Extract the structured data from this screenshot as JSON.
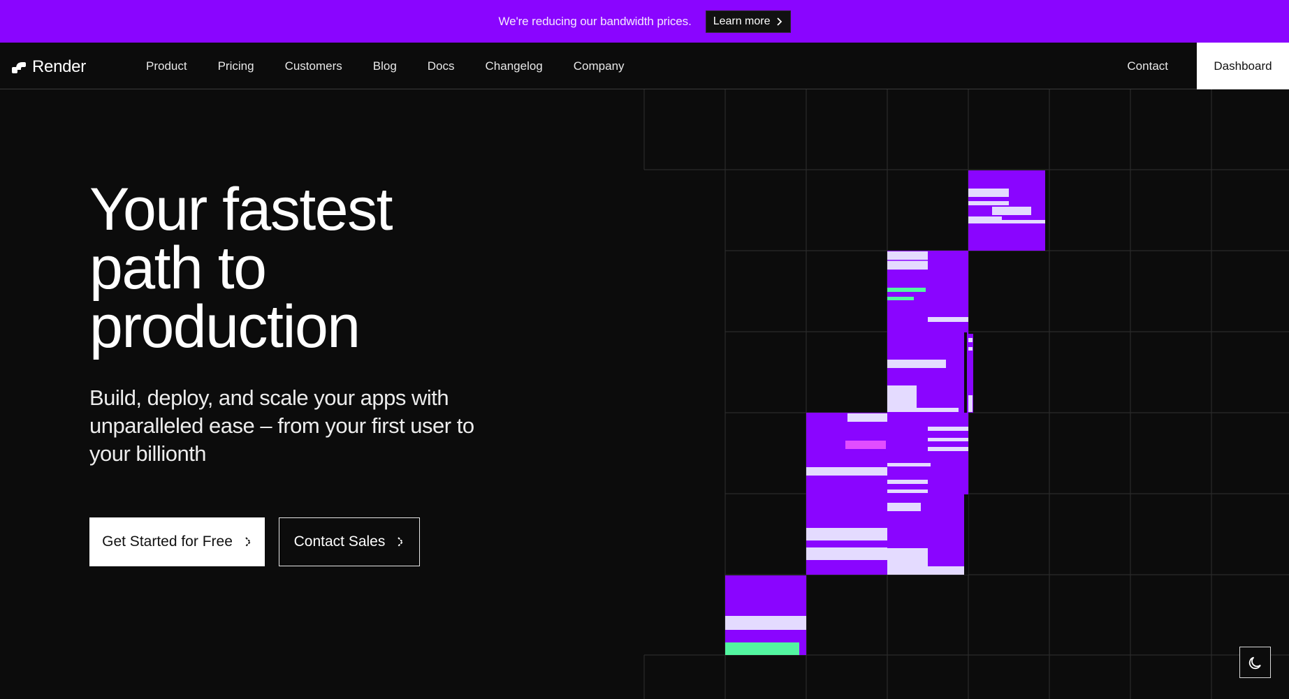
{
  "announcement": {
    "text": "We're reducing our bandwidth prices.",
    "button_label": "Learn more",
    "background": "#8a05ff"
  },
  "nav": {
    "logo_text": "Render",
    "links": [
      "Product",
      "Pricing",
      "Customers",
      "Blog",
      "Docs",
      "Changelog",
      "Company"
    ],
    "contact_label": "Contact",
    "dashboard_label": "Dashboard"
  },
  "hero": {
    "title_lines": [
      "Your fastest",
      "path to",
      "production"
    ],
    "subtitle_lines": [
      "Build, deploy, and scale your apps with",
      "unparalleled ease – from your first user to",
      "your billionth"
    ],
    "primary_cta": "Get Started for Free",
    "secondary_cta": "Contact Sales"
  },
  "colors": {
    "accent_purple": "#8a05ff",
    "light_lavender": "#e4dbff",
    "mint": "#53f5a0",
    "magenta": "#e24dff",
    "background": "#0c0c0c"
  },
  "icons": {
    "announcement_chevron": "chevron-right-icon",
    "cta_chevron": "chevron-right-icon",
    "theme_toggle": "moon-icon",
    "logo": "render-logo-icon"
  }
}
